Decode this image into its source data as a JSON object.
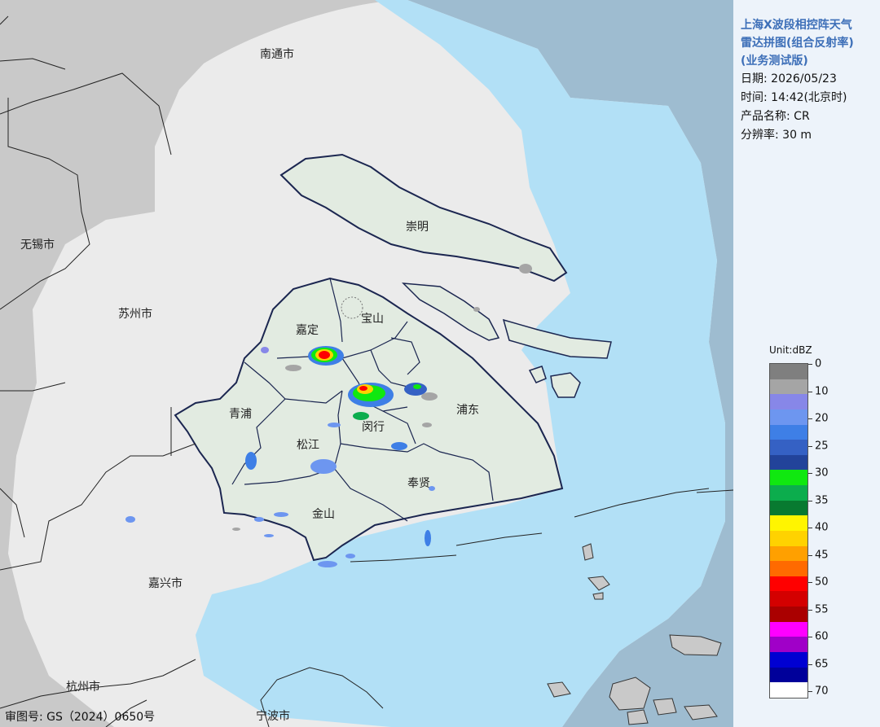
{
  "info_panel": {
    "title": [
      "上海X波段相控阵天气",
      "雷达拼图(组合反射率)",
      "(业务测试版)"
    ],
    "date": "日期: 2026/05/23",
    "time": "时间: 14:42(北京时)",
    "product": "产品名称: CR",
    "resolution": "分辨率: 30 m"
  },
  "legend": {
    "unit": "Unit:dBZ",
    "ticks": [
      "0",
      "10",
      "20",
      "25",
      "30",
      "35",
      "40",
      "45",
      "50",
      "55",
      "60",
      "65",
      "70"
    ],
    "colors": [
      "#7f7f7f",
      "#a5a5a5",
      "#8787e8",
      "#6d96f0",
      "#3e7fe6",
      "#3561c4",
      "#22439a",
      "#10e810",
      "#0cad4d",
      "#087a30",
      "#fff500",
      "#ffd200",
      "#ffa000",
      "#ff6a00",
      "#ff0000",
      "#d40000",
      "#aa0000",
      "#ff00ff",
      "#a000c8",
      "#0000d2",
      "#00009a",
      "#ffffff"
    ]
  },
  "labels": {
    "nantong": "南通市",
    "wuxi": "无锡市",
    "suzhou": "苏州市",
    "jiaxing": "嘉兴市",
    "hangzhou": "杭州市",
    "ningbo": "宁波市",
    "chongming": "崇明",
    "baoshan": "宝山",
    "jiading": "嘉定",
    "qingpu": "青浦",
    "songjiang": "松江",
    "minhang": "闵行",
    "pudong": "浦东",
    "fengxian": "奉贤",
    "jinshan": "金山"
  },
  "approval_number": "审图号: GS（2024）0650号",
  "colors": {
    "outside": "#c9c9c9",
    "coverage_land": "#ebebeb",
    "sea": "#9ebcd0",
    "coverage_water": "#b2e0f6",
    "shanghai_land": "#e2ebe1",
    "boundary": "#1b2650"
  }
}
